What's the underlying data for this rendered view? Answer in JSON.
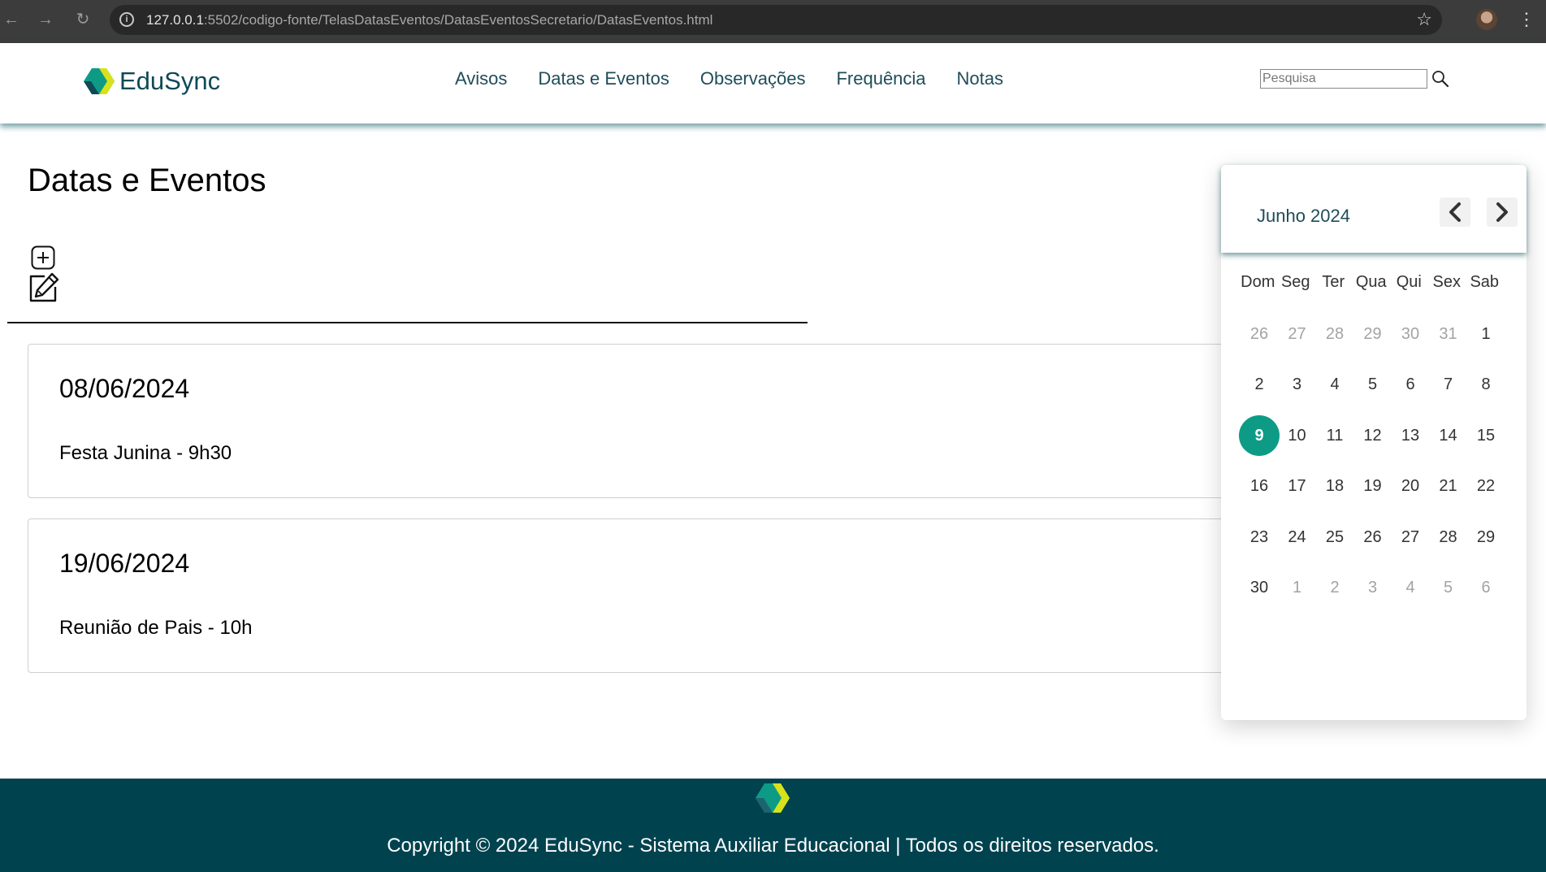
{
  "browser": {
    "url_host": "127.0.0.1",
    "url_rest": ":5502/codigo-fonte/TelasDatasEventos/DatasEventosSecretario/DatasEventos.html"
  },
  "header": {
    "brand": "EduSync",
    "nav": [
      "Avisos",
      "Datas e Eventos",
      "Observações",
      "Frequência",
      "Notas"
    ],
    "search_placeholder": "Pesquisa"
  },
  "main": {
    "title": "Datas e Eventos",
    "events": [
      {
        "date": "08/06/2024",
        "description": "Festa Junina - 9h30"
      },
      {
        "date": "19/06/2024",
        "description": "Reunião de Pais - 10h"
      }
    ]
  },
  "calendar": {
    "month_label": "Junho 2024",
    "weekdays": [
      "Dom",
      "Seg",
      "Ter",
      "Qua",
      "Qui",
      "Sex",
      "Sab"
    ],
    "days": [
      {
        "d": "26",
        "muted": true
      },
      {
        "d": "27",
        "muted": true
      },
      {
        "d": "28",
        "muted": true
      },
      {
        "d": "29",
        "muted": true
      },
      {
        "d": "30",
        "muted": true
      },
      {
        "d": "31",
        "muted": true
      },
      {
        "d": "1"
      },
      {
        "d": "2"
      },
      {
        "d": "3"
      },
      {
        "d": "4"
      },
      {
        "d": "5"
      },
      {
        "d": "6"
      },
      {
        "d": "7"
      },
      {
        "d": "8"
      },
      {
        "d": "9",
        "selected": true
      },
      {
        "d": "10"
      },
      {
        "d": "11"
      },
      {
        "d": "12"
      },
      {
        "d": "13"
      },
      {
        "d": "14"
      },
      {
        "d": "15"
      },
      {
        "d": "16"
      },
      {
        "d": "17"
      },
      {
        "d": "18"
      },
      {
        "d": "19"
      },
      {
        "d": "20"
      },
      {
        "d": "21"
      },
      {
        "d": "22"
      },
      {
        "d": "23"
      },
      {
        "d": "24"
      },
      {
        "d": "25"
      },
      {
        "d": "26"
      },
      {
        "d": "27"
      },
      {
        "d": "28"
      },
      {
        "d": "29"
      },
      {
        "d": "30"
      },
      {
        "d": "1",
        "muted": true
      },
      {
        "d": "2",
        "muted": true
      },
      {
        "d": "3",
        "muted": true
      },
      {
        "d": "4",
        "muted": true
      },
      {
        "d": "5",
        "muted": true
      },
      {
        "d": "6",
        "muted": true
      }
    ],
    "selected_color": "#0d9b86"
  },
  "footer": {
    "copyright": "Copyright © 2024 EduSync - Sistema Auxiliar Educacional | Todos os direitos reservados."
  },
  "colors": {
    "brand_dark": "#00434f",
    "nav_text": "#1e4d58",
    "accent": "#0d9b86"
  }
}
